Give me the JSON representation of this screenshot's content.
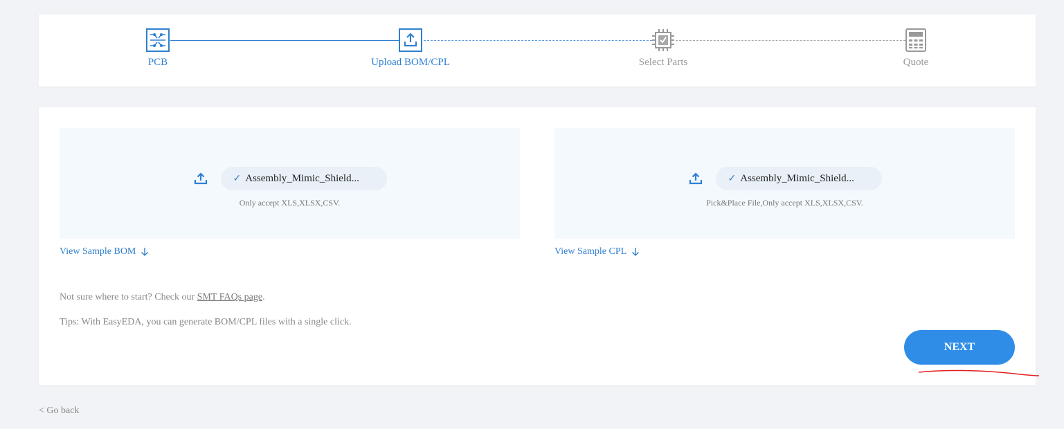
{
  "stepper": {
    "steps": [
      {
        "label": "PCB",
        "icon": "circuit-board-icon",
        "state": "active"
      },
      {
        "label": "Upload BOM/CPL",
        "icon": "upload-icon",
        "state": "active"
      },
      {
        "label": "Select Parts",
        "icon": "chip-check-icon",
        "state": "inactive"
      },
      {
        "label": "Quote",
        "icon": "calculator-icon",
        "state": "inactive"
      }
    ]
  },
  "bom": {
    "file_name": "Assembly_Mimic_Shield...",
    "hint": "Only accept XLS,XLSX,CSV.",
    "sample_link": "View Sample BOM"
  },
  "cpl": {
    "file_name": "Assembly_Mimic_Shield...",
    "hint": "Pick&Place File,Only accept XLS,XLSX,CSV.",
    "sample_link": "View Sample CPL"
  },
  "help": {
    "faq_prefix": "Not sure where to start? Check our ",
    "faq_link": "SMT FAQs page",
    "faq_suffix": ".",
    "tips": "Tips: With EasyEDA, you can generate BOM/CPL files with a single click."
  },
  "actions": {
    "next_label": "NEXT",
    "go_back_label": "< Go back"
  },
  "colors": {
    "accent": "#2f80d1",
    "button": "#2f8de8",
    "upload_bg": "#f4f9fe",
    "annotation": "#e02020"
  }
}
